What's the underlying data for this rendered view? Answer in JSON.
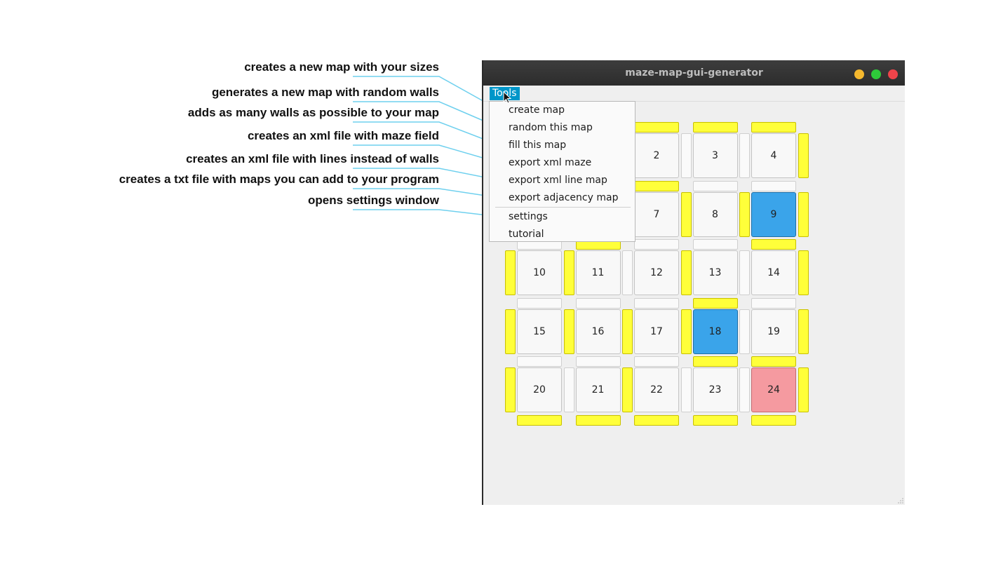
{
  "annotations": [
    "creates a new map with your sizes",
    "generates a new map with random walls",
    "adds as many walls as possible to your map",
    "creates an xml file with maze field",
    "creates an xml file with lines instead of walls",
    "creates a txt file with maps you can add to your program",
    "opens settings window"
  ],
  "window": {
    "title": "maze-map-gui-generator",
    "controls": {
      "minimize_color": "#f5b82e",
      "maximize_color": "#2ecb3a",
      "close_color": "#f0444a"
    }
  },
  "menubar": {
    "tools_label": "Tools"
  },
  "dropdown": {
    "items": [
      "create map",
      "random this map",
      "fill this map",
      "export xml maze",
      "export xml line map",
      "export adjacency map"
    ],
    "items_after_separator": [
      "settings",
      "tutorial"
    ]
  },
  "grid": {
    "cells": [
      {
        "label": "",
        "state": "normal"
      },
      {
        "label": "",
        "state": "normal"
      },
      {
        "label": "2",
        "state": "normal"
      },
      {
        "label": "3",
        "state": "normal"
      },
      {
        "label": "4",
        "state": "normal"
      },
      {
        "label": "",
        "state": "normal"
      },
      {
        "label": "",
        "state": "normal"
      },
      {
        "label": "7",
        "state": "normal"
      },
      {
        "label": "8",
        "state": "normal"
      },
      {
        "label": "9",
        "state": "start"
      },
      {
        "label": "10",
        "state": "normal"
      },
      {
        "label": "11",
        "state": "normal"
      },
      {
        "label": "12",
        "state": "normal"
      },
      {
        "label": "13",
        "state": "normal"
      },
      {
        "label": "14",
        "state": "normal"
      },
      {
        "label": "15",
        "state": "normal"
      },
      {
        "label": "16",
        "state": "normal"
      },
      {
        "label": "17",
        "state": "normal"
      },
      {
        "label": "18",
        "state": "start"
      },
      {
        "label": "19",
        "state": "normal"
      },
      {
        "label": "20",
        "state": "normal"
      },
      {
        "label": "21",
        "state": "normal"
      },
      {
        "label": "22",
        "state": "normal"
      },
      {
        "label": "23",
        "state": "normal"
      },
      {
        "label": "24",
        "state": "goal"
      }
    ],
    "horizontal_walls": [
      [
        true,
        true,
        true,
        true,
        true
      ],
      [
        false,
        false,
        true,
        false,
        false
      ],
      [
        false,
        true,
        false,
        false,
        true
      ],
      [
        false,
        false,
        false,
        true,
        false
      ],
      [
        false,
        false,
        false,
        true,
        true
      ],
      [
        true,
        true,
        true,
        true,
        true
      ]
    ],
    "vertical_walls": [
      [
        true,
        false,
        false,
        false,
        false,
        true
      ],
      [
        true,
        false,
        false,
        true,
        true,
        true
      ],
      [
        true,
        true,
        false,
        true,
        false,
        true
      ],
      [
        true,
        true,
        true,
        true,
        false,
        true
      ],
      [
        true,
        false,
        true,
        false,
        false,
        true
      ]
    ],
    "colors": {
      "wall_on": "#ffff3a",
      "start": "#3aa4ea",
      "goal": "#f59aa0"
    }
  }
}
